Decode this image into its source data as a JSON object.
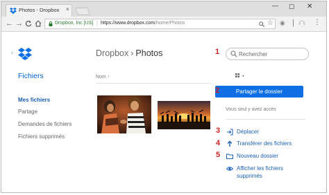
{
  "browser": {
    "tab_title": "Photos - Dropbox",
    "tab_close": "×",
    "window_controls": {
      "minimize": "—",
      "maximize": "☐",
      "close": "✕"
    },
    "nav": {
      "back": "←",
      "forward": "→",
      "reload": "C",
      "home": "⌂"
    },
    "site_identity": "Dropbox, Inc [US]",
    "url_host": "https://www.dropbox.com",
    "url_path": "/home/Photos"
  },
  "sidebar": {
    "heading": "Fichiers",
    "back_caret": "‹",
    "items": [
      {
        "label": "Mes fichiers",
        "active": true
      },
      {
        "label": "Partage",
        "active": false
      },
      {
        "label": "Demandes de fichiers",
        "active": false
      },
      {
        "label": "Fichiers supprimés",
        "active": false
      }
    ]
  },
  "main": {
    "breadcrumb_root": "Dropbox",
    "breadcrumb_sep": "›",
    "breadcrumb_current": "Photos",
    "column_name": "Nom",
    "sort_arrow": "↑"
  },
  "right_panel": {
    "search_placeholder": "Rechercher",
    "share_button": "Partager le dossier",
    "access_text": "Vous seul y avez accès",
    "actions": [
      {
        "label": "Déplacer",
        "icon": "move-icon"
      },
      {
        "label": "Transférer des fichiers",
        "icon": "upload-icon"
      },
      {
        "label": "Nouveau dossier",
        "icon": "folder-icon"
      },
      {
        "label": "Afficher les fichiers",
        "label2": "supprimés",
        "icon": "eye-icon"
      }
    ]
  },
  "annotations": [
    "1",
    "2",
    "3",
    "4",
    "5"
  ],
  "colors": {
    "brand_blue": "#0d6fe3",
    "link_blue": "#1a5fb4",
    "annotation_red": "#cc1f1f"
  }
}
